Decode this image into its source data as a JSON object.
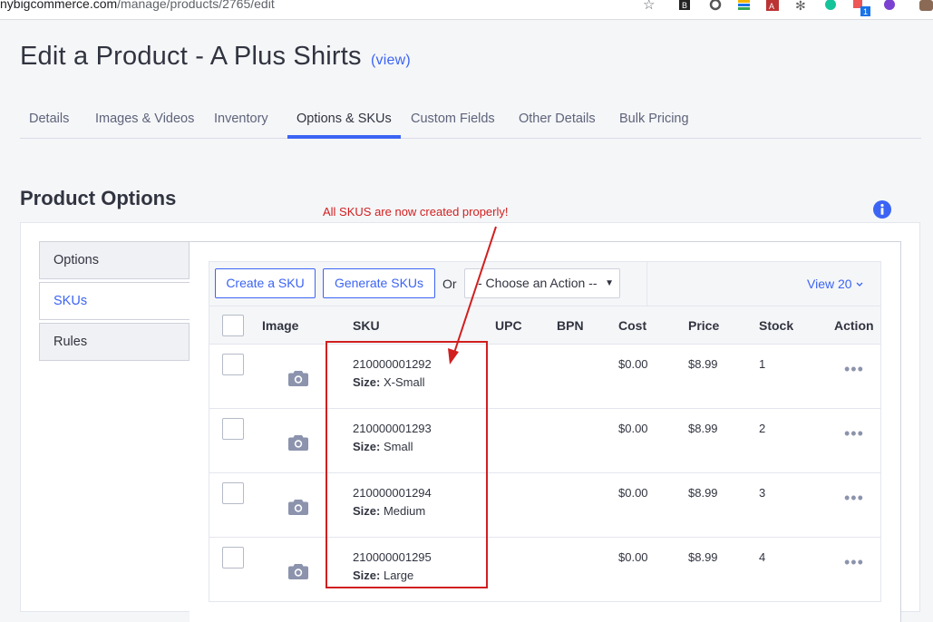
{
  "browser": {
    "url_prefix": "nybigcommerce.com",
    "url_path": "/manage/products/2765/edit",
    "extension_badge": "1"
  },
  "page": {
    "title": "Edit a Product - A Plus Shirts",
    "view_link": "(view)"
  },
  "tabs": [
    {
      "label": "Details"
    },
    {
      "label": "Images & Videos"
    },
    {
      "label": "Inventory"
    },
    {
      "label": "Options & SKUs"
    },
    {
      "label": "Custom Fields"
    },
    {
      "label": "Other Details"
    },
    {
      "label": "Bulk Pricing"
    }
  ],
  "active_tab": "Options & SKUs",
  "section": {
    "title": "Product Options"
  },
  "annotation": "All SKUS are now created properly!",
  "sidenav": [
    {
      "label": "Options"
    },
    {
      "label": "SKUs"
    },
    {
      "label": "Rules"
    }
  ],
  "toolbar": {
    "create_sku": "Create a SKU",
    "generate_skus": "Generate SKUs",
    "or": "Or",
    "action_select": "- Choose an Action --",
    "view_count": "View 20"
  },
  "table": {
    "headers": [
      "Image",
      "SKU",
      "UPC",
      "BPN",
      "Cost",
      "Price",
      "Stock",
      "Action"
    ],
    "option_label": "Size:",
    "rows": [
      {
        "sku": "210000001292",
        "size": "X-Small",
        "cost": "$0.00",
        "price": "$8.99",
        "stock": "1"
      },
      {
        "sku": "210000001293",
        "size": "Small",
        "cost": "$0.00",
        "price": "$8.99",
        "stock": "2"
      },
      {
        "sku": "210000001294",
        "size": "Medium",
        "cost": "$0.00",
        "price": "$8.99",
        "stock": "3"
      },
      {
        "sku": "210000001295",
        "size": "Large",
        "cost": "$0.00",
        "price": "$8.99",
        "stock": "4"
      }
    ]
  },
  "colors": {
    "accent": "#3c64f4",
    "annotation_red": "#d11f1f",
    "text": "#313440"
  }
}
